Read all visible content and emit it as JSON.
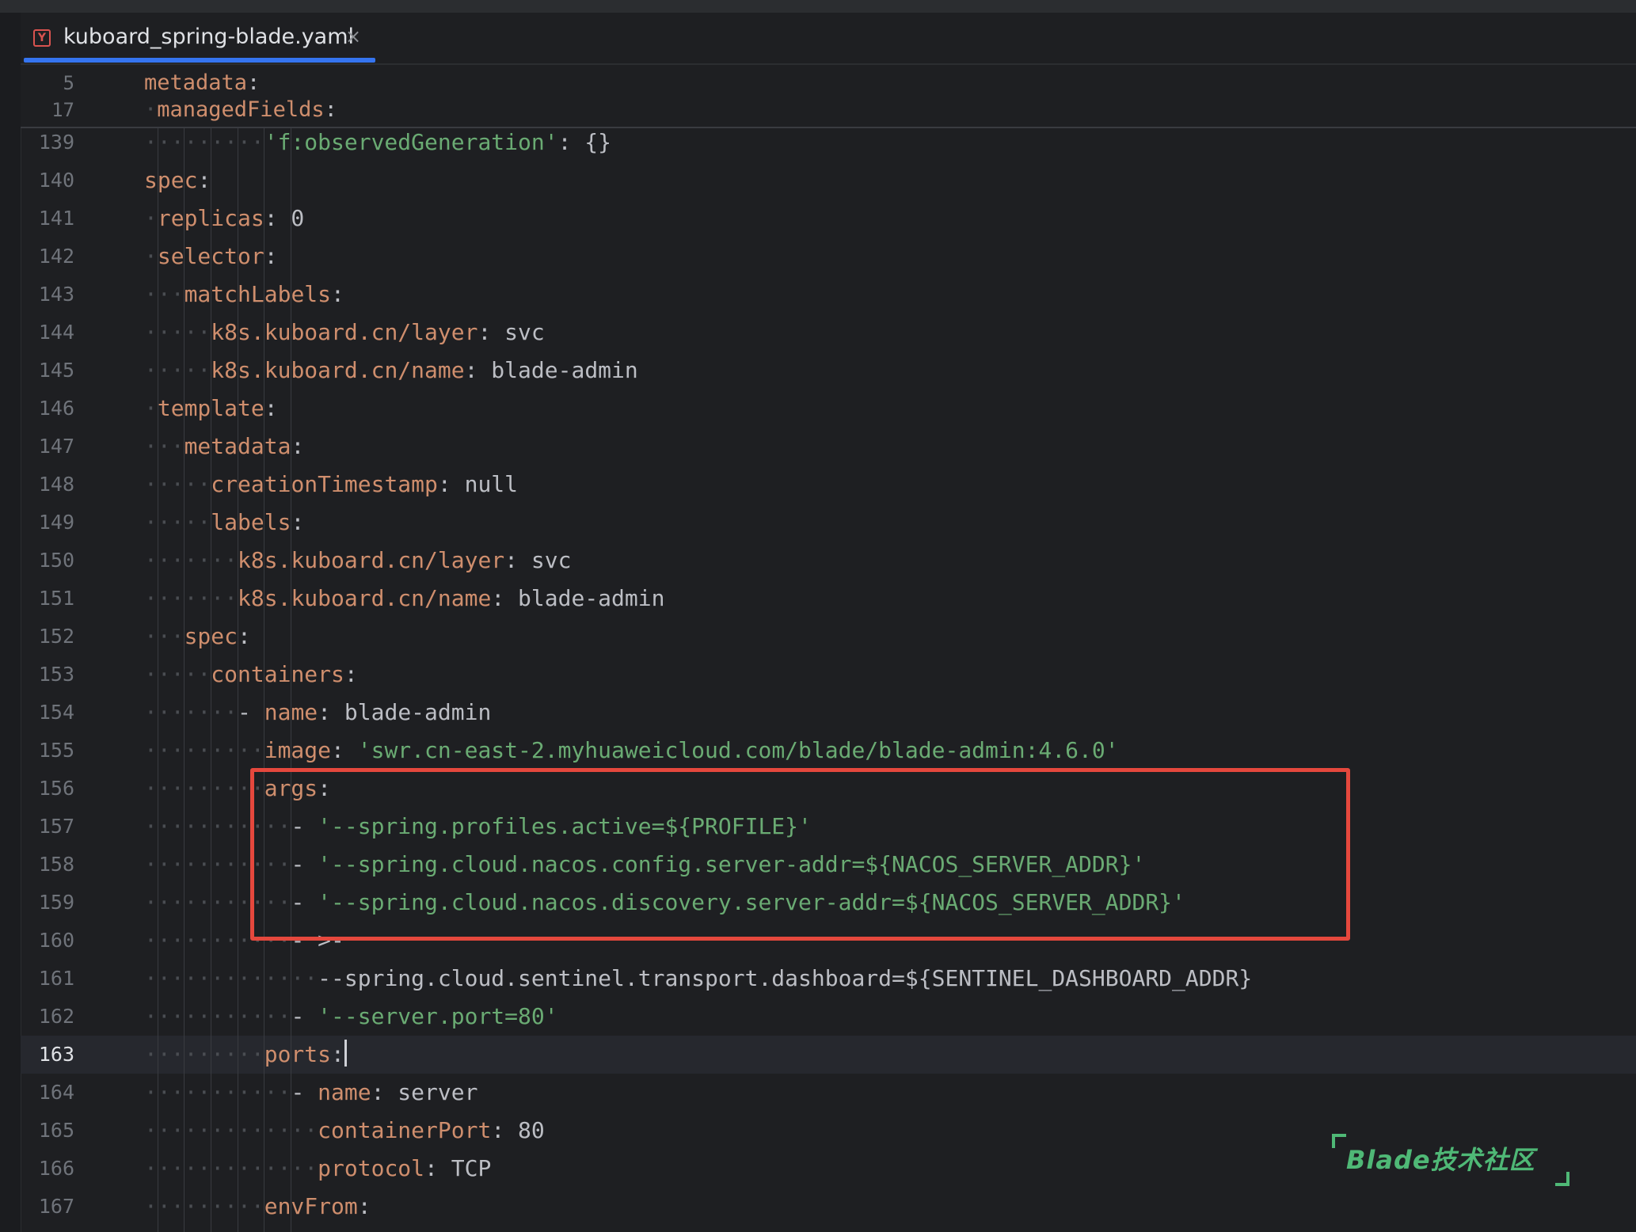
{
  "tab": {
    "icon": "yaml-file-icon",
    "label": "kuboard_spring-blade.yaml",
    "close": "×"
  },
  "sticky_lines": [
    {
      "num": "5",
      "dots": "",
      "key": "metadata",
      "sep": ":",
      "val": "",
      "str": ""
    },
    {
      "num": "17",
      "dots": "·",
      "key": "managedFields",
      "sep": ":",
      "val": "",
      "str": ""
    }
  ],
  "lines": [
    {
      "num": "139",
      "dots": "·········",
      "key": "",
      "pre": "'f:observedGeneration'",
      "sep": ":",
      "val": " {}",
      "str": "",
      "str_key": true
    },
    {
      "num": "140",
      "dots": "",
      "key": "spec",
      "sep": ":",
      "val": "",
      "str": ""
    },
    {
      "num": "141",
      "dots": "·",
      "key": "replicas",
      "sep": ":",
      "val": " 0",
      "str": ""
    },
    {
      "num": "142",
      "dots": "·",
      "key": "selector",
      "sep": ":",
      "val": "",
      "str": ""
    },
    {
      "num": "143",
      "dots": "···",
      "key": "matchLabels",
      "sep": ":",
      "val": "",
      "str": ""
    },
    {
      "num": "144",
      "dots": "·····",
      "key": "k8s.kuboard.cn/layer",
      "sep": ":",
      "val": " svc",
      "str": ""
    },
    {
      "num": "145",
      "dots": "·····",
      "key": "k8s.kuboard.cn/name",
      "sep": ":",
      "val": " blade-admin",
      "str": ""
    },
    {
      "num": "146",
      "dots": "·",
      "key": "template",
      "sep": ":",
      "val": "",
      "str": ""
    },
    {
      "num": "147",
      "dots": "···",
      "key": "metadata",
      "sep": ":",
      "val": "",
      "str": ""
    },
    {
      "num": "148",
      "dots": "·····",
      "key": "creationTimestamp",
      "sep": ":",
      "val": " null",
      "str": ""
    },
    {
      "num": "149",
      "dots": "·····",
      "key": "labels",
      "sep": ":",
      "val": "",
      "str": ""
    },
    {
      "num": "150",
      "dots": "·······",
      "key": "k8s.kuboard.cn/layer",
      "sep": ":",
      "val": " svc",
      "str": ""
    },
    {
      "num": "151",
      "dots": "·······",
      "key": "k8s.kuboard.cn/name",
      "sep": ":",
      "val": " blade-admin",
      "str": ""
    },
    {
      "num": "152",
      "dots": "···",
      "key": "spec",
      "sep": ":",
      "val": "",
      "str": ""
    },
    {
      "num": "153",
      "dots": "·····",
      "key": "containers",
      "sep": ":",
      "val": "",
      "str": ""
    },
    {
      "num": "154",
      "dots": "·······",
      "dash": "- ",
      "key": "name",
      "sep": ":",
      "val": " blade-admin",
      "str": ""
    },
    {
      "num": "155",
      "dots": "·········",
      "key": "image",
      "sep": ":",
      "val": " ",
      "str": "'swr.cn-east-2.myhuaweicloud.com/blade/blade-admin:4.6.0'"
    },
    {
      "num": "156",
      "dots": "·········",
      "key": "args",
      "sep": ":",
      "val": "",
      "str": ""
    },
    {
      "num": "157",
      "dots": "···········",
      "dash": "- ",
      "key": "",
      "sep": "",
      "val": "",
      "str": "'--spring.profiles.active=${PROFILE}'"
    },
    {
      "num": "158",
      "dots": "···········",
      "dash": "- ",
      "key": "",
      "sep": "",
      "val": "",
      "str": "'--spring.cloud.nacos.config.server-addr=${NACOS_SERVER_ADDR}'"
    },
    {
      "num": "159",
      "dots": "···········",
      "dash": "- ",
      "key": "",
      "sep": "",
      "val": "",
      "str": "'--spring.cloud.nacos.discovery.server-addr=${NACOS_SERVER_ADDR}'"
    },
    {
      "num": "160",
      "dots": "···········",
      "dash": "- ",
      "key": "",
      "sep": "",
      "val": ">-",
      "str": ""
    },
    {
      "num": "161",
      "dots": "·············",
      "key": "",
      "sep": "",
      "val": "--spring.cloud.sentinel.transport.dashboard=${SENTINEL_DASHBOARD_ADDR}",
      "str": ""
    },
    {
      "num": "162",
      "dots": "···········",
      "dash": "- ",
      "key": "",
      "sep": "",
      "val": "",
      "str": "'--server.port=80'"
    },
    {
      "num": "163",
      "dots": "·········",
      "key": "ports",
      "sep": ":",
      "val": "",
      "str": "",
      "current": true
    },
    {
      "num": "164",
      "dots": "···········",
      "dash": "- ",
      "key": "name",
      "sep": ":",
      "val": " server",
      "str": ""
    },
    {
      "num": "165",
      "dots": "·············",
      "key": "containerPort",
      "sep": ":",
      "val": " 80",
      "str": ""
    },
    {
      "num": "166",
      "dots": "·············",
      "key": "protocol",
      "sep": ":",
      "val": " TCP",
      "str": ""
    },
    {
      "num": "167",
      "dots": "·········",
      "key": "envFrom",
      "sep": ":",
      "val": "",
      "str": ""
    }
  ],
  "watermark": "Blade技术社区",
  "colors": {
    "background": "#1e1f22",
    "key": "#cf8e6d",
    "string": "#6aab73",
    "text": "#bcbec4",
    "highlight_box": "#e5483d",
    "tab_underline": "#3574f0",
    "watermark": "#4fb876"
  }
}
